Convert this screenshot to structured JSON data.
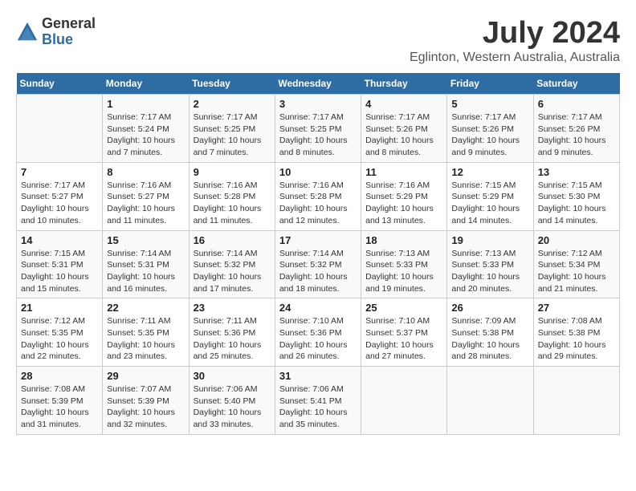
{
  "logo": {
    "general": "General",
    "blue": "Blue"
  },
  "title": "July 2024",
  "subtitle": "Eglinton, Western Australia, Australia",
  "days_header": [
    "Sunday",
    "Monday",
    "Tuesday",
    "Wednesday",
    "Thursday",
    "Friday",
    "Saturday"
  ],
  "weeks": [
    [
      {
        "day": "",
        "info": ""
      },
      {
        "day": "1",
        "info": "Sunrise: 7:17 AM\nSunset: 5:24 PM\nDaylight: 10 hours\nand 7 minutes."
      },
      {
        "day": "2",
        "info": "Sunrise: 7:17 AM\nSunset: 5:25 PM\nDaylight: 10 hours\nand 7 minutes."
      },
      {
        "day": "3",
        "info": "Sunrise: 7:17 AM\nSunset: 5:25 PM\nDaylight: 10 hours\nand 8 minutes."
      },
      {
        "day": "4",
        "info": "Sunrise: 7:17 AM\nSunset: 5:26 PM\nDaylight: 10 hours\nand 8 minutes."
      },
      {
        "day": "5",
        "info": "Sunrise: 7:17 AM\nSunset: 5:26 PM\nDaylight: 10 hours\nand 9 minutes."
      },
      {
        "day": "6",
        "info": "Sunrise: 7:17 AM\nSunset: 5:26 PM\nDaylight: 10 hours\nand 9 minutes."
      }
    ],
    [
      {
        "day": "7",
        "info": "Sunrise: 7:17 AM\nSunset: 5:27 PM\nDaylight: 10 hours\nand 10 minutes."
      },
      {
        "day": "8",
        "info": "Sunrise: 7:16 AM\nSunset: 5:27 PM\nDaylight: 10 hours\nand 11 minutes."
      },
      {
        "day": "9",
        "info": "Sunrise: 7:16 AM\nSunset: 5:28 PM\nDaylight: 10 hours\nand 11 minutes."
      },
      {
        "day": "10",
        "info": "Sunrise: 7:16 AM\nSunset: 5:28 PM\nDaylight: 10 hours\nand 12 minutes."
      },
      {
        "day": "11",
        "info": "Sunrise: 7:16 AM\nSunset: 5:29 PM\nDaylight: 10 hours\nand 13 minutes."
      },
      {
        "day": "12",
        "info": "Sunrise: 7:15 AM\nSunset: 5:29 PM\nDaylight: 10 hours\nand 14 minutes."
      },
      {
        "day": "13",
        "info": "Sunrise: 7:15 AM\nSunset: 5:30 PM\nDaylight: 10 hours\nand 14 minutes."
      }
    ],
    [
      {
        "day": "14",
        "info": "Sunrise: 7:15 AM\nSunset: 5:31 PM\nDaylight: 10 hours\nand 15 minutes."
      },
      {
        "day": "15",
        "info": "Sunrise: 7:14 AM\nSunset: 5:31 PM\nDaylight: 10 hours\nand 16 minutes."
      },
      {
        "day": "16",
        "info": "Sunrise: 7:14 AM\nSunset: 5:32 PM\nDaylight: 10 hours\nand 17 minutes."
      },
      {
        "day": "17",
        "info": "Sunrise: 7:14 AM\nSunset: 5:32 PM\nDaylight: 10 hours\nand 18 minutes."
      },
      {
        "day": "18",
        "info": "Sunrise: 7:13 AM\nSunset: 5:33 PM\nDaylight: 10 hours\nand 19 minutes."
      },
      {
        "day": "19",
        "info": "Sunrise: 7:13 AM\nSunset: 5:33 PM\nDaylight: 10 hours\nand 20 minutes."
      },
      {
        "day": "20",
        "info": "Sunrise: 7:12 AM\nSunset: 5:34 PM\nDaylight: 10 hours\nand 21 minutes."
      }
    ],
    [
      {
        "day": "21",
        "info": "Sunrise: 7:12 AM\nSunset: 5:35 PM\nDaylight: 10 hours\nand 22 minutes."
      },
      {
        "day": "22",
        "info": "Sunrise: 7:11 AM\nSunset: 5:35 PM\nDaylight: 10 hours\nand 23 minutes."
      },
      {
        "day": "23",
        "info": "Sunrise: 7:11 AM\nSunset: 5:36 PM\nDaylight: 10 hours\nand 25 minutes."
      },
      {
        "day": "24",
        "info": "Sunrise: 7:10 AM\nSunset: 5:36 PM\nDaylight: 10 hours\nand 26 minutes."
      },
      {
        "day": "25",
        "info": "Sunrise: 7:10 AM\nSunset: 5:37 PM\nDaylight: 10 hours\nand 27 minutes."
      },
      {
        "day": "26",
        "info": "Sunrise: 7:09 AM\nSunset: 5:38 PM\nDaylight: 10 hours\nand 28 minutes."
      },
      {
        "day": "27",
        "info": "Sunrise: 7:08 AM\nSunset: 5:38 PM\nDaylight: 10 hours\nand 29 minutes."
      }
    ],
    [
      {
        "day": "28",
        "info": "Sunrise: 7:08 AM\nSunset: 5:39 PM\nDaylight: 10 hours\nand 31 minutes."
      },
      {
        "day": "29",
        "info": "Sunrise: 7:07 AM\nSunset: 5:39 PM\nDaylight: 10 hours\nand 32 minutes."
      },
      {
        "day": "30",
        "info": "Sunrise: 7:06 AM\nSunset: 5:40 PM\nDaylight: 10 hours\nand 33 minutes."
      },
      {
        "day": "31",
        "info": "Sunrise: 7:06 AM\nSunset: 5:41 PM\nDaylight: 10 hours\nand 35 minutes."
      },
      {
        "day": "",
        "info": ""
      },
      {
        "day": "",
        "info": ""
      },
      {
        "day": "",
        "info": ""
      }
    ]
  ]
}
